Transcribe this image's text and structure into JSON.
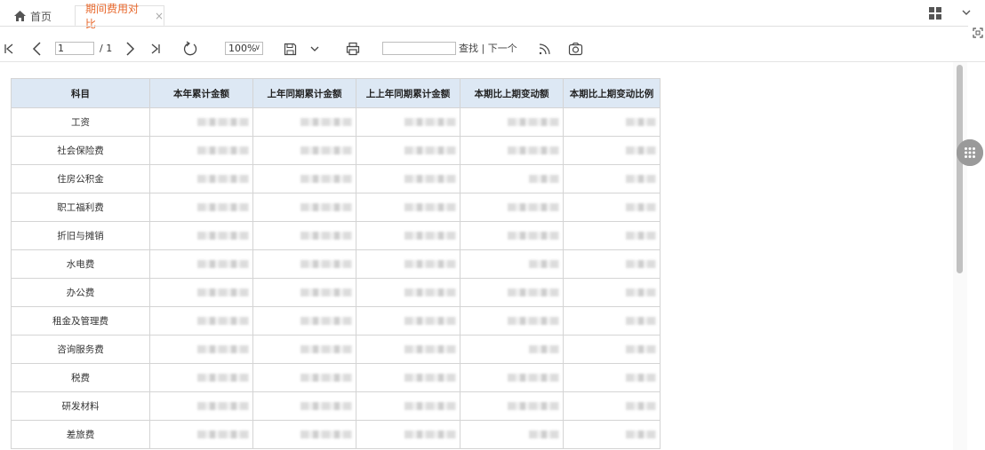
{
  "tabs": {
    "home_label": "首页",
    "active_label": "期间费用对比",
    "close_symbol": "×"
  },
  "toolbar": {
    "page_value": "1",
    "page_total": "/ 1",
    "zoom_value": "100%",
    "find_links": "查找 | 下一个"
  },
  "report": {
    "headers": [
      "科目",
      "本年累计金额",
      "上年同期累计金额",
      "上上年同期累计金额",
      "本期比上期变动额",
      "本期比上期变动比例"
    ],
    "rows": [
      "工资",
      "社会保险费",
      "住房公积金",
      "职工福利费",
      "折旧与摊销",
      "水电费",
      "办公费",
      "租金及管理费",
      "咨询服务费",
      "税费",
      "研发材料",
      "差旅费"
    ]
  },
  "colors": {
    "accent_tab": "#e8682c",
    "header_bg": "#dde8f4"
  }
}
